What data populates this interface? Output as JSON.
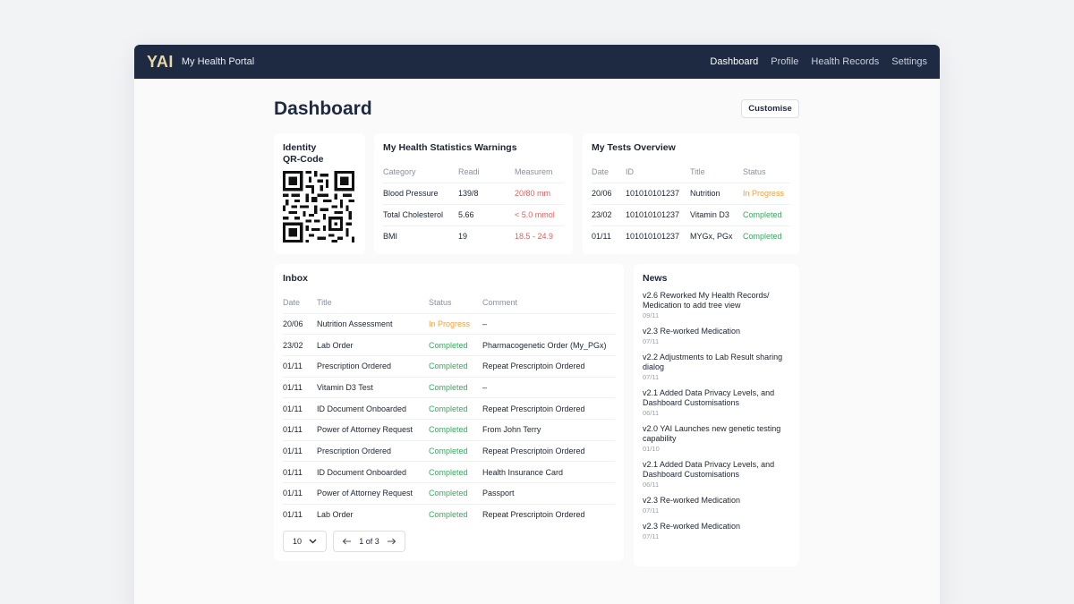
{
  "app": {
    "logo": "YAI",
    "title": "My Health Portal"
  },
  "nav": [
    "Dashboard",
    "Profile",
    "Health Records",
    "Settings"
  ],
  "page": {
    "title": "Dashboard",
    "customise_label": "Customise"
  },
  "identity": {
    "title_line1": "Identity",
    "title_line2": "QR-Code"
  },
  "stats": {
    "title": "My Health Statistics Warnings",
    "headers": [
      "Category",
      "Readi",
      "Measurem"
    ],
    "rows": [
      [
        "Blood Pressure",
        "139/8",
        "20/80 mm"
      ],
      [
        "Total Cholesterol",
        "5.66",
        "< 5.0 mmol"
      ],
      [
        "BMI",
        "19",
        "18.5 - 24.9"
      ]
    ]
  },
  "tests": {
    "title": "My Tests Overview",
    "headers": [
      "Date",
      "ID",
      "Title",
      "Status"
    ],
    "rows": [
      [
        "20/06",
        "101010101237",
        "Nutrition",
        "In Progress"
      ],
      [
        "23/02",
        "101010101237",
        "Vitamin D3",
        "Completed"
      ],
      [
        "01/11",
        "101010101237",
        "MYGx, PGx",
        "Completed"
      ]
    ]
  },
  "inbox": {
    "title": "Inbox",
    "headers": [
      "Date",
      "Title",
      "Status",
      "Comment"
    ],
    "rows": [
      [
        "20/06",
        "Nutrition Assessment",
        "In Progress",
        "–"
      ],
      [
        "23/02",
        "Lab Order",
        "Completed",
        "Pharmacogenetic Order (My_PGx)"
      ],
      [
        "01/11",
        "Prescription Ordered",
        "Completed",
        "Repeat Prescriptoin Ordered"
      ],
      [
        "01/11",
        "Vitamin D3 Test",
        "Completed",
        "–"
      ],
      [
        "01/11",
        "ID Document Onboarded",
        "Completed",
        "Repeat Prescriptoin Ordered"
      ],
      [
        "01/11",
        "Power of Attorney Request",
        "Completed",
        "From John Terry"
      ],
      [
        "01/11",
        "Prescription Ordered",
        "Completed",
        "Repeat Prescriptoin Ordered"
      ],
      [
        "01/11",
        "ID Document Onboarded",
        "Completed",
        "Health Insurance Card"
      ],
      [
        "01/11",
        "Power of Attorney Request",
        "Completed",
        "Passport"
      ],
      [
        "01/11",
        "Lab Order",
        "Completed",
        "Repeat Prescriptoin Ordered"
      ]
    ],
    "page_size": "10",
    "page_label": "1 of 3"
  },
  "news": {
    "title": "News",
    "items": [
      {
        "text": "v2.6 Reworked My Health Records/ Medication to add tree view",
        "date": "09/11"
      },
      {
        "text": "v2.3 Re-worked Medication",
        "date": "07/11"
      },
      {
        "text": "v2.2 Adjustments to Lab Result sharing dialog",
        "date": "07/11"
      },
      {
        "text": "v2.1 Added Data Privacy Levels, and Dashboard Customisations",
        "date": "06/11"
      },
      {
        "text": "v2.0 YAI Launches new genetic testing capability",
        "date": "01/10"
      },
      {
        "text": "v2.1 Added Data Privacy Levels, and Dashboard Customisations",
        "date": "06/11"
      },
      {
        "text": "v2.3 Re-worked Medication",
        "date": "07/11"
      },
      {
        "text": "v2.3 Re-worked Medication",
        "date": "07/11"
      }
    ]
  },
  "colors": {
    "nav_bg": "#1e2942",
    "logo": "#e8d7a8",
    "warning": "#e0625c",
    "in_progress": "#f0a040",
    "completed": "#3aa860"
  },
  "icons": {
    "page_size_dropdown": "chevron-down-icon",
    "prev": "arrow-left-icon",
    "next": "arrow-right-icon"
  }
}
